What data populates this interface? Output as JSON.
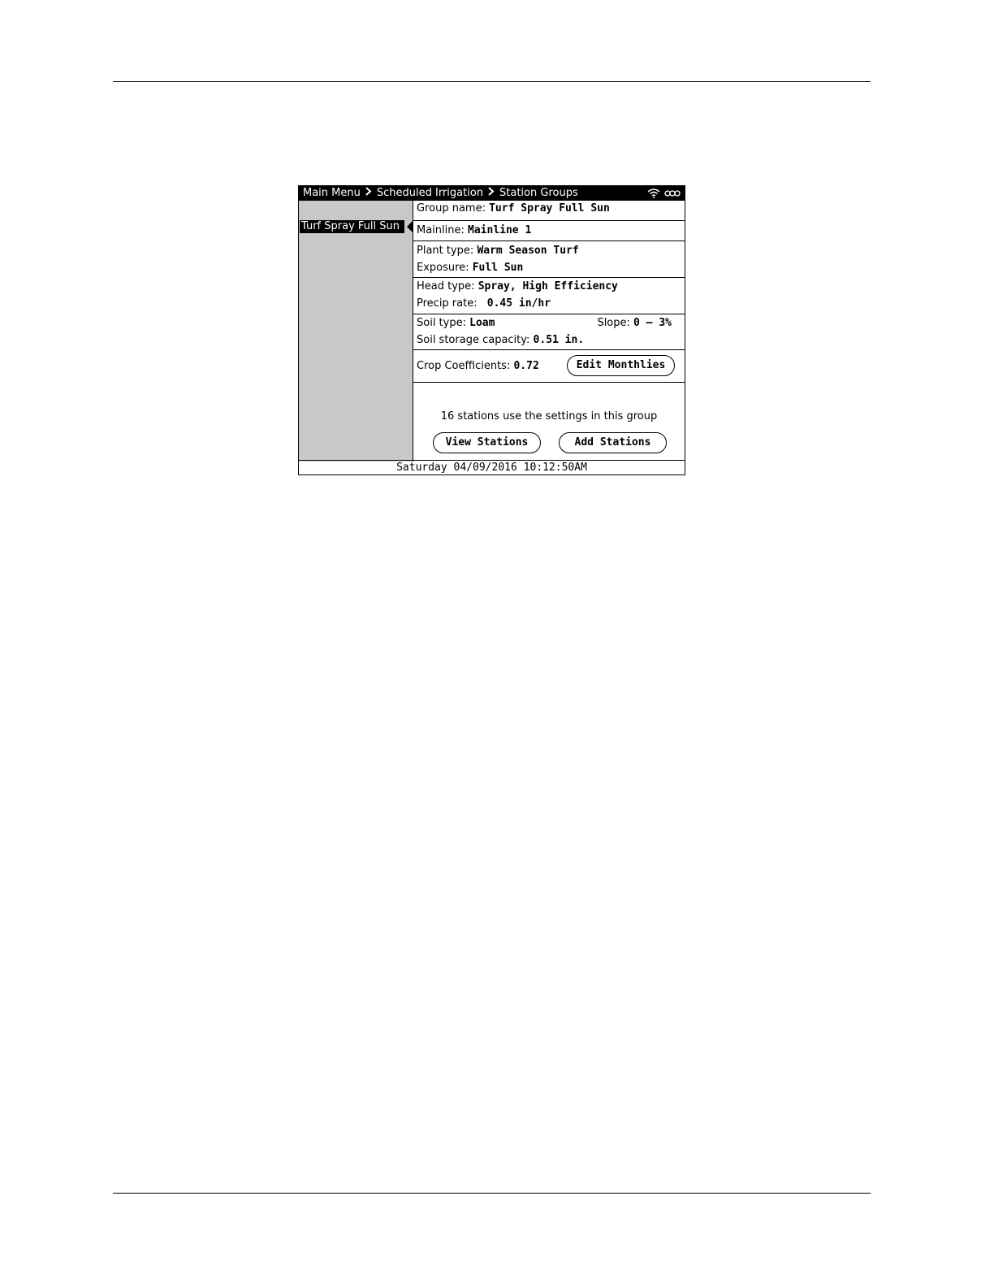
{
  "breadcrumb": [
    "Main Menu",
    "Scheduled Irrigation",
    "Station Groups"
  ],
  "icons": {
    "wifi": "wifi-icon",
    "battery": "battery-icon",
    "separator": "chevron-right-icon"
  },
  "sidebar": {
    "items": [
      {
        "label": "Turf Spray Full Sun",
        "selected": true
      }
    ]
  },
  "group": {
    "name_label": "Group name:",
    "name_value": "Turf Spray Full Sun",
    "mainline_label": "Mainline:",
    "mainline_value": "Mainline 1",
    "plant_type_label": "Plant type:",
    "plant_type_value": "Warm Season Turf",
    "exposure_label": "Exposure:",
    "exposure_value": "Full Sun",
    "head_type_label": "Head type:",
    "head_type_value": "Spray, High Efficiency",
    "precip_label": "Precip rate:",
    "precip_value": "0.45 in/hr",
    "soil_type_label": "Soil type:",
    "soil_type_value": "Loam",
    "slope_label": "Slope:",
    "slope_value": "0 – 3%",
    "soil_storage_label": "Soil storage capacity:",
    "soil_storage_value": "0.51 in.",
    "crop_label": "Crop Coefficients:",
    "crop_value": "0.72"
  },
  "buttons": {
    "edit_monthlies": "Edit Monthlies",
    "view_stations": "View Stations",
    "add_stations": "Add Stations"
  },
  "usage_text": "16 stations use the settings in this group",
  "footer": {
    "datetime": "Saturday  04/09/2016  10:12:50AM"
  }
}
